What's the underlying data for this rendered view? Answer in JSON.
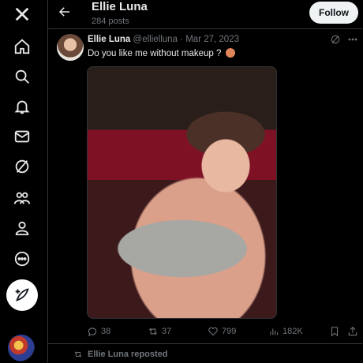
{
  "header": {
    "title": "Ellie Luna",
    "post_count": "284 posts",
    "follow_label": "Follow"
  },
  "sidebar": {
    "items": [
      {
        "icon": "x-logo-icon"
      },
      {
        "icon": "home-icon"
      },
      {
        "icon": "search-icon"
      },
      {
        "icon": "notifications-bell-icon"
      },
      {
        "icon": "messages-envelope-icon"
      },
      {
        "icon": "grok-icon"
      },
      {
        "icon": "communities-icon"
      },
      {
        "icon": "profile-icon"
      },
      {
        "icon": "more-circle-icon"
      },
      {
        "icon": "compose-post-icon"
      }
    ]
  },
  "tweet": {
    "author_name": "Ellie Luna",
    "handle": "@ellielluna",
    "date": "Mar 27, 2023",
    "text": "Do you like me without makeup ?",
    "emoji": "person-gesturing-emoji",
    "actions": {
      "replies": "38",
      "reposts": "37",
      "likes": "799",
      "views": "182K"
    }
  },
  "next": {
    "repost_text": "Ellie Luna reposted"
  },
  "colors": {
    "background": "#000000",
    "text": "#e7e9ea",
    "muted": "#71767b",
    "border": "#2f3336",
    "follow_bg": "#eff3f4"
  }
}
